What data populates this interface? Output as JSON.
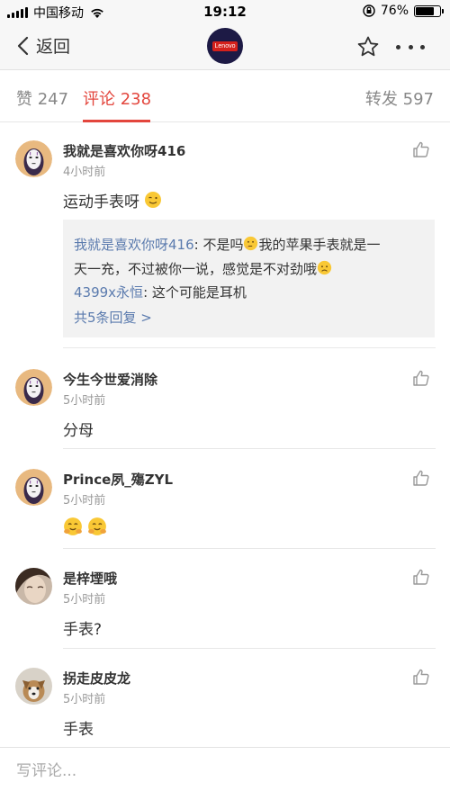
{
  "status_bar": {
    "carrier": "中国移动",
    "time": "19:12",
    "battery_percent": "76%",
    "battery_level": 0.76
  },
  "nav": {
    "back_label": "返回",
    "logo_text": "Lenovo",
    "icons": [
      "chevron-left-icon",
      "star-icon",
      "more-icon"
    ]
  },
  "tabs": {
    "likes": "赞 247",
    "comments": "评论 238",
    "reposts": "转发 597",
    "active": "comments",
    "accent_color": "#e3463d"
  },
  "comments": [
    {
      "name": "我就是喜欢你呀416",
      "time": "4小时前",
      "text": "运动手表呀",
      "replies": [
        {
          "name": "我就是喜欢你呀416",
          "text_line1": ": 不是吗",
          "text_line1b": "我的苹果手表就是一",
          "text_line2": "天一充，不过被你一说，感觉是不对劲哦"
        },
        {
          "name": "4399x永恒",
          "text": ": 这个可能是耳机"
        }
      ],
      "more_replies": "共5条回复 >"
    },
    {
      "name": "今生今世爱消除",
      "time": "5小时前",
      "text": "分母"
    },
    {
      "name": "Prince夙_殤ZYL",
      "time": "5小时前",
      "text": ""
    },
    {
      "name": "是梓堙哦",
      "time": "5小时前",
      "text": "手表?"
    },
    {
      "name": "拐走皮皮龙",
      "time": "5小时前",
      "text": "手表"
    }
  ],
  "bottom": {
    "placeholder": "写评论..."
  },
  "colors": {
    "link": "#5b7bae",
    "muted": "#999999",
    "background": "#ffffff",
    "reply_bg": "#f2f2f2"
  }
}
